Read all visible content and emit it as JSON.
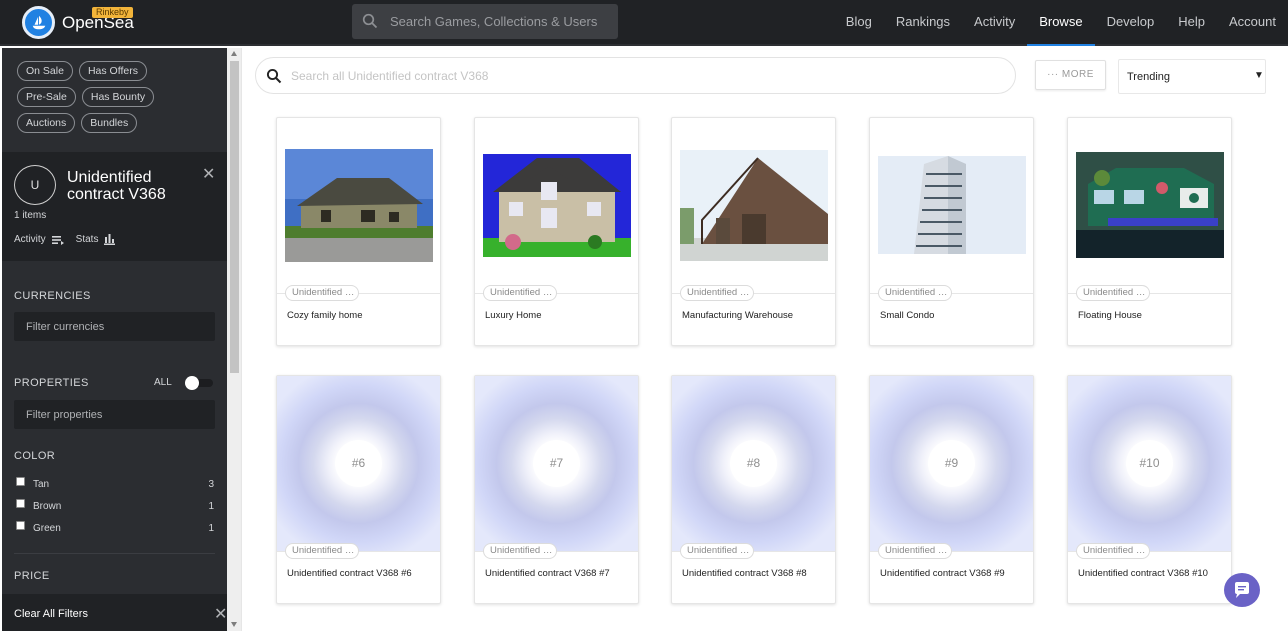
{
  "brand": {
    "name": "OpenSea",
    "network_badge": "Rinkeby",
    "logo_icon": "opensea-logo-icon"
  },
  "nav": {
    "search_placeholder": "Search Games, Collections & Users",
    "links": [
      "Blog",
      "Rankings",
      "Activity",
      "Browse",
      "Develop",
      "Help",
      "Account"
    ],
    "active": "Browse"
  },
  "sidebar": {
    "chips": [
      [
        "On Sale",
        "Has Offers"
      ],
      [
        "Pre-Sale",
        "Has Bounty"
      ],
      [
        "Auctions",
        "Bundles"
      ]
    ],
    "collection": {
      "avatar_letter": "U",
      "name": "Unidentified contract V368",
      "items": "1 items",
      "activity_label": "Activity",
      "stats_label": "Stats"
    },
    "currencies": {
      "title": "CURRENCIES",
      "placeholder": "Filter currencies"
    },
    "properties": {
      "title": "PROPERTIES",
      "all_label": "ALL",
      "placeholder": "Filter properties"
    },
    "color": {
      "title": "COLOR",
      "options": [
        {
          "name": "Tan",
          "count": "3"
        },
        {
          "name": "Brown",
          "count": "1"
        },
        {
          "name": "Green",
          "count": "1"
        }
      ]
    },
    "price": {
      "title": "PRICE"
    },
    "clear_all": "Clear All Filters"
  },
  "main": {
    "search_placeholder": "Search all Unidentified contract V368",
    "more_label": "··· MORE",
    "sort_value": "Trending",
    "cards": [
      {
        "collection": "Unidentified contract V368",
        "title": "Cozy family home",
        "image": "house-photo"
      },
      {
        "collection": "Unidentified contract V368",
        "title": "Luxury Home",
        "image": "house-photo"
      },
      {
        "collection": "Unidentified contract V368",
        "title": "Manufacturing Warehouse",
        "image": "barn-photo"
      },
      {
        "collection": "Unidentified contract V368",
        "title": "Small Condo",
        "image": "condo-photo"
      },
      {
        "collection": "Unidentified contract V368",
        "title": "Floating House",
        "image": "houseboat-photo"
      },
      {
        "collection": "Unidentified contract V368",
        "title": "Unidentified contract V368 #6",
        "placeholder": "#6"
      },
      {
        "collection": "Unidentified contract V368",
        "title": "Unidentified contract V368 #7",
        "placeholder": "#7"
      },
      {
        "collection": "Unidentified contract V368",
        "title": "Unidentified contract V368 #8",
        "placeholder": "#8"
      },
      {
        "collection": "Unidentified contract V368",
        "title": "Unidentified contract V368 #9",
        "placeholder": "#9"
      },
      {
        "collection": "Unidentified contract V368",
        "title": "Unidentified contract V368 #10",
        "placeholder": "#10"
      }
    ]
  },
  "colors": {
    "nav_bg": "#202225",
    "sidebar_bg": "#2b2d31",
    "accent": "#2081e2",
    "chat_bubble": "#6a62c6"
  }
}
